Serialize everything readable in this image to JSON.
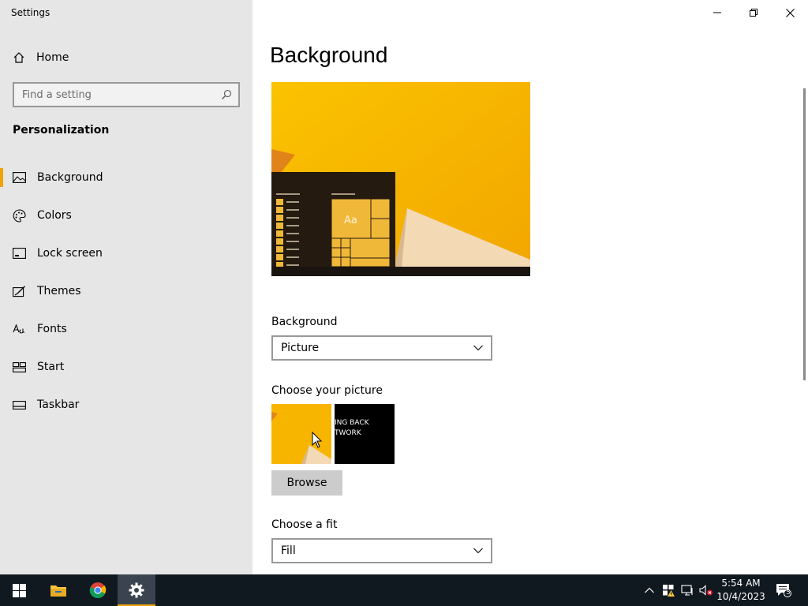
{
  "window": {
    "title": "Settings"
  },
  "sidebar": {
    "home_label": "Home",
    "search_placeholder": "Find a setting",
    "section": "Personalization",
    "items": [
      {
        "label": "Background",
        "icon": "picture-icon",
        "active": true
      },
      {
        "label": "Colors",
        "icon": "palette-icon",
        "active": false
      },
      {
        "label": "Lock screen",
        "icon": "lock-screen-icon",
        "active": false
      },
      {
        "label": "Themes",
        "icon": "themes-icon",
        "active": false
      },
      {
        "label": "Fonts",
        "icon": "fonts-icon",
        "active": false
      },
      {
        "label": "Start",
        "icon": "start-icon",
        "active": false
      },
      {
        "label": "Taskbar",
        "icon": "taskbar-icon",
        "active": false
      }
    ]
  },
  "main": {
    "title": "Background",
    "preview_tile_text": "Aa",
    "background_label": "Background",
    "background_value": "Picture",
    "choose_picture_label": "Choose your picture",
    "thumb2_lines": [
      "ING BACK",
      "TWORK"
    ],
    "browse_label": "Browse",
    "fit_label": "Choose a fit",
    "fit_value": "Fill"
  },
  "taskbar": {
    "time": "5:54 AM",
    "date": "10/4/2023",
    "notification_count": "5"
  },
  "colors": {
    "accent": "#f0a30a",
    "sidebar_bg": "#e6e6e6",
    "taskbar_bg": "#101820",
    "wallpaper_yellow": "#f8b500"
  }
}
